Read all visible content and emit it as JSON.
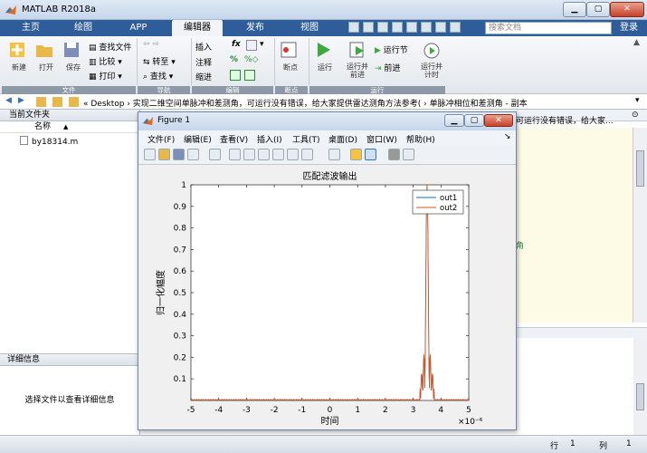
{
  "app": {
    "title": "MATLAB R2018a"
  },
  "tabs": [
    {
      "label": "主页"
    },
    {
      "label": "绘图"
    },
    {
      "label": "APP"
    },
    {
      "label": "编辑器"
    },
    {
      "label": "发布"
    },
    {
      "label": "视图"
    }
  ],
  "search": {
    "placeholder": "搜索文档"
  },
  "login_label": "登录",
  "ribbon": {
    "file": {
      "new": "新建",
      "open": "打开",
      "save": "保存",
      "find_files": "查找文件",
      "compare": "比较",
      "print": "打印",
      "section": "文件"
    },
    "nav": {
      "goto": "转至",
      "find": "查找",
      "section": "导航"
    },
    "edit": {
      "insert": "插入",
      "comment": "注释",
      "indent": "缩进",
      "section": "编辑"
    },
    "breakpoints": {
      "label": "断点",
      "section": "断点"
    },
    "run": {
      "run": "运行",
      "run_advance": "运行并\n前进",
      "run_section": "运行节",
      "advance": "前进",
      "run_time": "运行并\n计时",
      "section": "运行"
    }
  },
  "address": {
    "path": "«  Desktop  ›  实现二维空间单脉冲和差测角，可运行没有错误，给大家提供雷达测角方法参考(  ›  单脉冲相位和差测角 - 副本"
  },
  "left_panel": {
    "header": "当前文件夹",
    "col_name": "名称",
    "col_sort": "▲",
    "files": [
      {
        "name": "by18314.m"
      }
    ]
  },
  "details": {
    "header": "详细信息",
    "message": "选择文件以查看详细信息"
  },
  "editor_snippet": {
    "line1": "可运行没有错误，给大家...",
    "line2": "角"
  },
  "status": {
    "row_label": "行",
    "row_value": "1",
    "col_label": "列",
    "col_value": "1"
  },
  "figure": {
    "title": "Figure 1",
    "menu": [
      "文件(F)",
      "编辑(E)",
      "查看(V)",
      "插入(I)",
      "工具(T)",
      "桌面(D)",
      "窗口(W)",
      "帮助(H)"
    ]
  },
  "chart_data": {
    "type": "line",
    "title": "匹配滤波输出",
    "xlabel": "时间",
    "ylabel": "归一化幅度",
    "x_exponent": "×10⁻⁶",
    "xlim": [
      -5,
      5
    ],
    "ylim": [
      0,
      1
    ],
    "xticks": [
      -5,
      -4,
      -3,
      -2,
      -1,
      0,
      1,
      2,
      3,
      4,
      5
    ],
    "yticks": [
      0.1,
      0.2,
      0.3,
      0.4,
      0.5,
      0.6,
      0.7,
      0.8,
      0.9,
      1
    ],
    "legend_position": "top-right",
    "grid": false,
    "series": [
      {
        "name": "out1",
        "color": "#0072bd",
        "peak_x": 3.5,
        "peak_y": 1.0
      },
      {
        "name": "out2",
        "color": "#d95319",
        "peak_x": 3.5,
        "peak_y": 1.0
      }
    ]
  }
}
